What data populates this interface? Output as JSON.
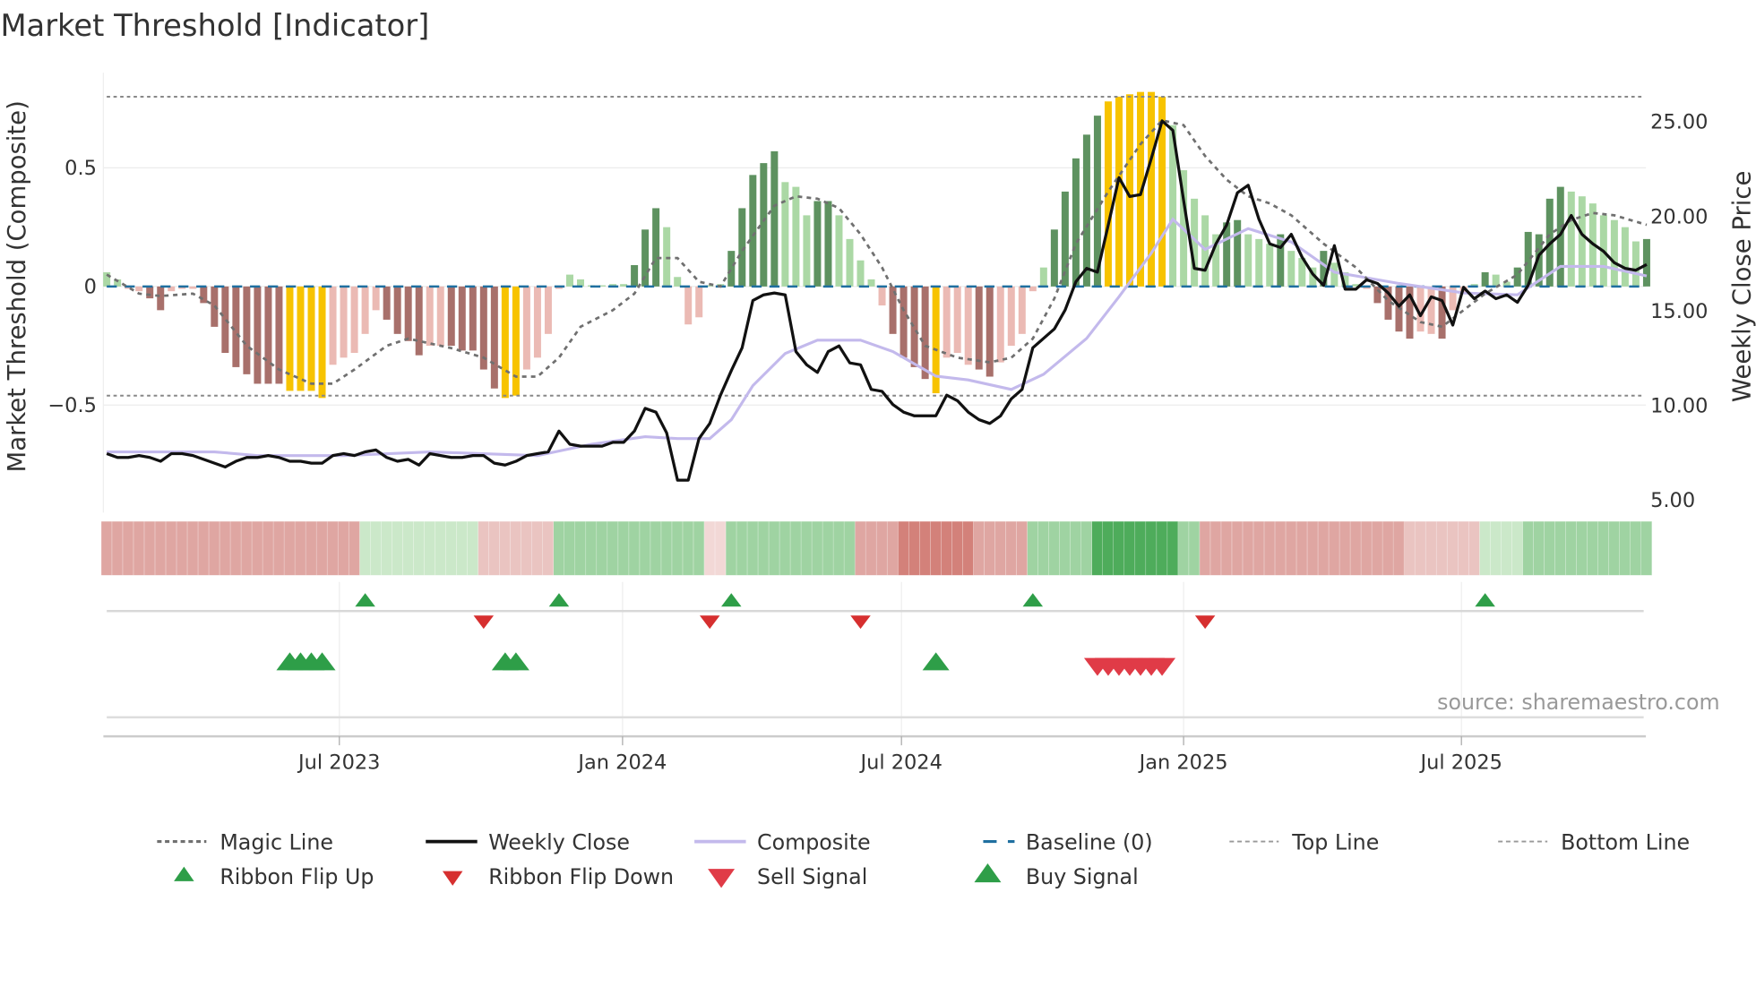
{
  "title": "Market Threshold [Indicator]",
  "source": "source: sharemaestro.com",
  "colors": {
    "dark_green": "#5e9260",
    "light_green": "#abd8a5",
    "dark_red": "#a8706b",
    "light_red": "#ebbab4",
    "yellow": "#f7c300",
    "close": "#111111",
    "composite": "#c3b9ec",
    "magic": "#707070",
    "baseline": "#1f6fa0",
    "flip_up": "#2e9e48",
    "flip_down": "#d62f2f",
    "sell": "#e03b47",
    "buy": "#2e9e48"
  },
  "chart_data": {
    "type": "bar",
    "title": "Market Threshold [Indicator]",
    "ylabel": "Market Threshold (Composite)",
    "y2label": "Weekly Close Price",
    "ylim": [
      -0.9,
      0.9
    ],
    "y2lim": [
      5,
      26
    ],
    "yticks": [
      {
        "v": 0.5,
        "label": "0.5"
      },
      {
        "v": 0,
        "label": "0"
      },
      {
        "v": -0.5,
        "label": "−0.5"
      }
    ],
    "y2ticks": [
      {
        "v": 25,
        "label": "25.00"
      },
      {
        "v": 20,
        "label": "20.00"
      },
      {
        "v": 15,
        "label": "15.00"
      },
      {
        "v": 10,
        "label": "10.00"
      },
      {
        "v": 5,
        "label": "5.00"
      }
    ],
    "xticks": [
      {
        "week": 21.6,
        "label": "Jul 2023"
      },
      {
        "week": 47.9,
        "label": "Jan 2024"
      },
      {
        "week": 73.8,
        "label": "Jul 2024"
      },
      {
        "week": 100,
        "label": "Jan 2025"
      },
      {
        "week": 125.8,
        "label": "Jul 2025"
      }
    ],
    "top_line": 0.8,
    "bottom_line": -0.46,
    "composite_bars": [
      0.06,
      0.03,
      -0.01,
      -0.02,
      -0.05,
      -0.1,
      -0.02,
      -0.01,
      -0.01,
      -0.07,
      -0.17,
      -0.28,
      -0.34,
      -0.37,
      -0.41,
      -0.41,
      -0.41,
      -0.44,
      -0.44,
      -0.44,
      -0.47,
      -0.33,
      -0.3,
      -0.28,
      -0.2,
      -0.1,
      -0.14,
      -0.2,
      -0.23,
      -0.29,
      -0.25,
      -0.25,
      -0.25,
      -0.27,
      -0.27,
      -0.35,
      -0.43,
      -0.47,
      -0.46,
      -0.35,
      -0.3,
      -0.2,
      -0.01,
      0.05,
      0.03,
      0.005,
      0.005,
      0.01,
      0.01,
      0.09,
      0.24,
      0.33,
      0.25,
      0.04,
      -0.16,
      -0.13,
      0.005,
      0.01,
      0.15,
      0.33,
      0.47,
      0.52,
      0.57,
      0.44,
      0.42,
      0.3,
      0.36,
      0.36,
      0.3,
      0.2,
      0.11,
      0.03,
      -0.08,
      -0.2,
      -0.3,
      -0.34,
      -0.39,
      -0.45,
      -0.3,
      -0.28,
      -0.33,
      -0.35,
      -0.38,
      -0.32,
      -0.25,
      -0.2,
      -0.02,
      0.08,
      0.24,
      0.4,
      0.54,
      0.64,
      0.72,
      0.78,
      0.8,
      0.81,
      0.82,
      0.82,
      0.8,
      0.68,
      0.49,
      0.37,
      0.3,
      0.22,
      0.27,
      0.28,
      0.22,
      0.2,
      0.18,
      0.22,
      0.15,
      0.12,
      0.08,
      0.15,
      0.1,
      0.06,
      0.01,
      -0.01,
      -0.07,
      -0.14,
      -0.19,
      -0.22,
      -0.19,
      -0.2,
      -0.22,
      -0.1,
      -0.03,
      0.01,
      0.06,
      0.05,
      0.02,
      0.08,
      0.23,
      0.22,
      0.37,
      0.42,
      0.4,
      0.38,
      0.35,
      0.3,
      0.28,
      0.25,
      0.19,
      0.2
    ],
    "bar_colors": "lg lg lr lr dr dr lr lr lr dr dr dr dr dr dr dr dr y y y y lr lr lr lr lr dr dr dr dr lr lr dr dr dr dr dr y y lr lr lr lr lg lg lg lg lg lg dg dg dg lg lg lr lr lg lg dg dg dg dg dg lg lg lg dg dg lg lg lg lg lr dr dr dr dr y lr lr lr dr dr lr lr lr lr lg dg dg dg dg dg y y y y y y lg lg lg lg lg dg dg lg lg lg dg lg lg lg dg lg lg lg lr dr dr dr dr lr lr dr lr lr lg dg lg lg dg dg dg dg dg lg lg lg lg lg lg lg dg",
    "weekly_close": [
      7.4,
      7.2,
      7.2,
      7.3,
      7.2,
      7.0,
      7.4,
      7.4,
      7.3,
      7.1,
      6.9,
      6.7,
      7.0,
      7.2,
      7.2,
      7.3,
      7.2,
      7.0,
      7.0,
      6.9,
      6.9,
      7.3,
      7.4,
      7.3,
      7.5,
      7.6,
      7.2,
      7.0,
      7.1,
      6.8,
      7.4,
      7.3,
      7.2,
      7.2,
      7.3,
      7.3,
      6.9,
      6.8,
      7.0,
      7.3,
      7.4,
      7.5,
      8.6,
      7.9,
      7.8,
      7.8,
      7.8,
      8.0,
      8.0,
      8.6,
      9.8,
      9.6,
      8.5,
      6.0,
      6.0,
      8.2,
      9.0,
      10.5,
      11.8,
      13.0,
      15.5,
      15.8,
      15.9,
      15.8,
      12.8,
      12.1,
      11.7,
      12.8,
      13.1,
      12.2,
      12.1,
      10.8,
      10.7,
      10.0,
      9.6,
      9.4,
      9.4,
      9.4,
      10.5,
      10.2,
      9.6,
      9.2,
      9.0,
      9.4,
      10.3,
      10.8,
      13.0,
      13.5,
      14.0,
      15.0,
      16.5,
      17.2,
      17.0,
      19.5,
      22.0,
      21.0,
      21.1,
      23.0,
      25.0,
      24.5,
      20.8,
      17.2,
      17.1,
      18.5,
      19.5,
      21.2,
      21.6,
      19.8,
      18.5,
      18.3,
      19.0,
      17.8,
      16.9,
      16.3,
      18.4,
      16.1,
      16.1,
      16.6,
      16.4,
      15.9,
      15.2,
      15.8,
      14.7,
      15.7,
      15.5,
      14.2,
      16.2,
      15.6,
      16.0,
      15.6,
      15.8,
      15.4,
      16.3,
      17.9,
      18.5,
      19.0,
      20.0,
      19.0,
      18.5,
      18.1,
      17.5,
      17.2,
      17.1,
      17.4
    ],
    "composite_line_points": [
      [
        0,
        7.5
      ],
      [
        10,
        7.5
      ],
      [
        14,
        7.3
      ],
      [
        22,
        7.3
      ],
      [
        30,
        7.5
      ],
      [
        40,
        7.3
      ],
      [
        45,
        7.9
      ],
      [
        50,
        8.3
      ],
      [
        53,
        8.2
      ],
      [
        56,
        8.2
      ],
      [
        58,
        9.2
      ],
      [
        60,
        11.0
      ],
      [
        63,
        12.7
      ],
      [
        66,
        13.4
      ],
      [
        70,
        13.4
      ],
      [
        73,
        12.8
      ],
      [
        77,
        11.5
      ],
      [
        80,
        11.3
      ],
      [
        84,
        10.8
      ],
      [
        87,
        11.6
      ],
      [
        91,
        13.5
      ],
      [
        94,
        15.7
      ],
      [
        97,
        18.0
      ],
      [
        99,
        19.8
      ],
      [
        102,
        18.2
      ],
      [
        106,
        19.3
      ],
      [
        110,
        18.6
      ],
      [
        114,
        17.0
      ],
      [
        120,
        16.4
      ],
      [
        126,
        15.9
      ],
      [
        131,
        15.8
      ],
      [
        135,
        17.3
      ],
      [
        139,
        17.3
      ],
      [
        143,
        16.8
      ]
    ],
    "magic_line_points": [
      [
        0,
        0.05
      ],
      [
        3,
        -0.03
      ],
      [
        5,
        -0.04
      ],
      [
        8,
        -0.03
      ],
      [
        10,
        -0.08
      ],
      [
        13,
        -0.25
      ],
      [
        16,
        -0.35
      ],
      [
        19,
        -0.41
      ],
      [
        21,
        -0.41
      ],
      [
        23,
        -0.35
      ],
      [
        26,
        -0.25
      ],
      [
        28,
        -0.22
      ],
      [
        32,
        -0.26
      ],
      [
        35,
        -0.3
      ],
      [
        38,
        -0.38
      ],
      [
        40,
        -0.38
      ],
      [
        42,
        -0.3
      ],
      [
        44,
        -0.17
      ],
      [
        47,
        -0.1
      ],
      [
        49,
        -0.03
      ],
      [
        51,
        0.12
      ],
      [
        53,
        0.12
      ],
      [
        55,
        0.02
      ],
      [
        57,
        0
      ],
      [
        59,
        0.15
      ],
      [
        62,
        0.34
      ],
      [
        64,
        0.38
      ],
      [
        66,
        0.37
      ],
      [
        68,
        0.33
      ],
      [
        70,
        0.22
      ],
      [
        72,
        0.08
      ],
      [
        74,
        -0.1
      ],
      [
        76,
        -0.25
      ],
      [
        79,
        -0.3
      ],
      [
        82,
        -0.32
      ],
      [
        84,
        -0.3
      ],
      [
        86,
        -0.22
      ],
      [
        88,
        -0.05
      ],
      [
        90,
        0.18
      ],
      [
        93,
        0.4
      ],
      [
        96,
        0.6
      ],
      [
        98,
        0.7
      ],
      [
        100,
        0.68
      ],
      [
        102,
        0.55
      ],
      [
        104,
        0.45
      ],
      [
        106,
        0.38
      ],
      [
        108,
        0.35
      ],
      [
        110,
        0.3
      ],
      [
        113,
        0.18
      ],
      [
        116,
        0.08
      ],
      [
        119,
        -0.06
      ],
      [
        122,
        -0.15
      ],
      [
        124,
        -0.17
      ],
      [
        126,
        -0.1
      ],
      [
        128,
        -0.03
      ],
      [
        131,
        0.05
      ],
      [
        134,
        0.22
      ],
      [
        136,
        0.28
      ],
      [
        138,
        0.31
      ],
      [
        140,
        0.3
      ],
      [
        143,
        0.26
      ]
    ],
    "ribbon_runs": [
      [
        0,
        23,
        -2
      ],
      [
        24,
        34,
        1
      ],
      [
        35,
        41,
        -1
      ],
      [
        42,
        55,
        2
      ],
      [
        56,
        57,
        -0.5
      ],
      [
        58,
        69,
        2
      ],
      [
        70,
        73,
        -2
      ],
      [
        74,
        80,
        -3
      ],
      [
        81,
        85,
        -2
      ],
      [
        86,
        91,
        2
      ],
      [
        92,
        99,
        3
      ],
      [
        100,
        101,
        2
      ],
      [
        102,
        120,
        -2
      ],
      [
        121,
        127,
        -1
      ],
      [
        128,
        131,
        1
      ],
      [
        132,
        143,
        2
      ]
    ],
    "ribbon_flip_up": [
      24,
      42,
      58,
      86,
      128
    ],
    "ribbon_flip_down": [
      35,
      56,
      70,
      102
    ],
    "buy_signals": [
      17,
      18,
      19,
      20,
      37,
      38,
      77
    ],
    "sell_signals": [
      92,
      93,
      94,
      95,
      96,
      97,
      98
    ],
    "legend": {
      "row1": [
        "Magic Line",
        "Weekly Close",
        "Composite",
        "Baseline (0)",
        "Top Line",
        "Bottom Line"
      ],
      "row2": [
        "Ribbon Flip Up",
        "Ribbon Flip Down",
        "Sell Signal",
        "Buy Signal"
      ]
    }
  }
}
